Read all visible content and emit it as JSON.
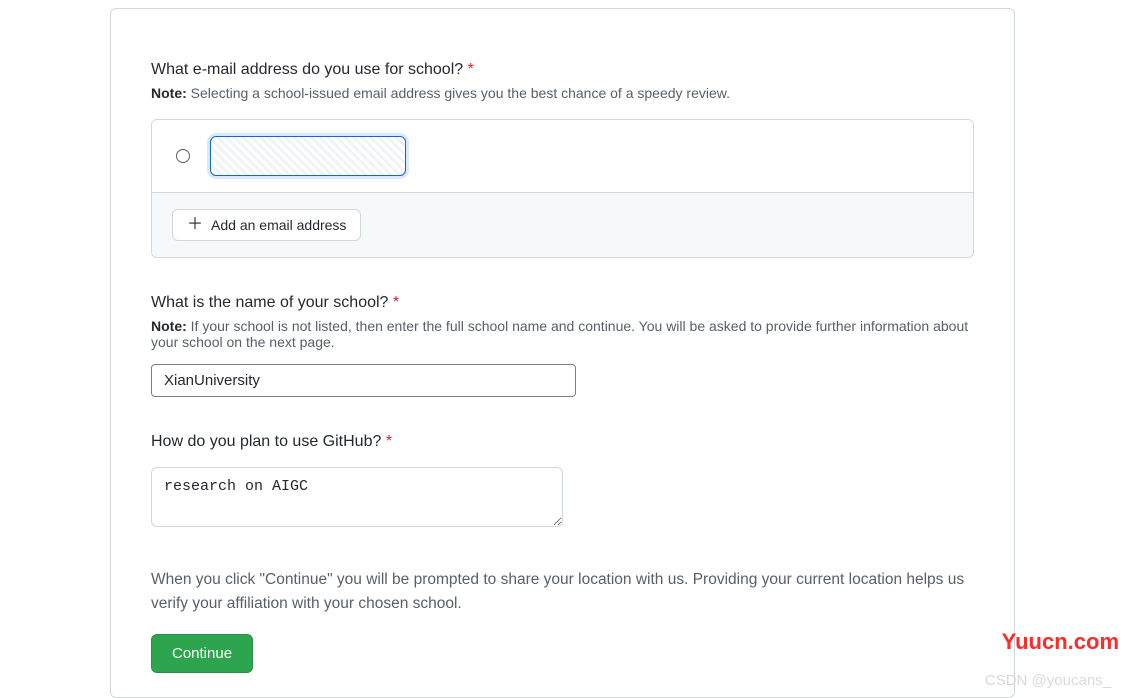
{
  "email_section": {
    "question": "What e-mail address do you use for school?",
    "note_label": "Note:",
    "note_text": "Selecting a school-issued email address gives you the best chance of a speedy review.",
    "add_button": "Add an email address"
  },
  "school_section": {
    "question": "What is the name of your school?",
    "note_label": "Note:",
    "note_text": "If your school is not listed, then enter the full school name and continue. You will be asked to provide further information about your school on the next page.",
    "value": "XianUniversity"
  },
  "plan_section": {
    "question": "How do you plan to use GitHub?",
    "value": "research on AIGC"
  },
  "disclaimer": "When you click \"Continue\" you will be prompted to share your location with us. Providing your current location helps us verify your affiliation with your chosen school.",
  "continue_label": "Continue",
  "watermark_bottom": "CSDN @youcans_",
  "watermark_side": "Yuucn.com",
  "required_marker": "*"
}
